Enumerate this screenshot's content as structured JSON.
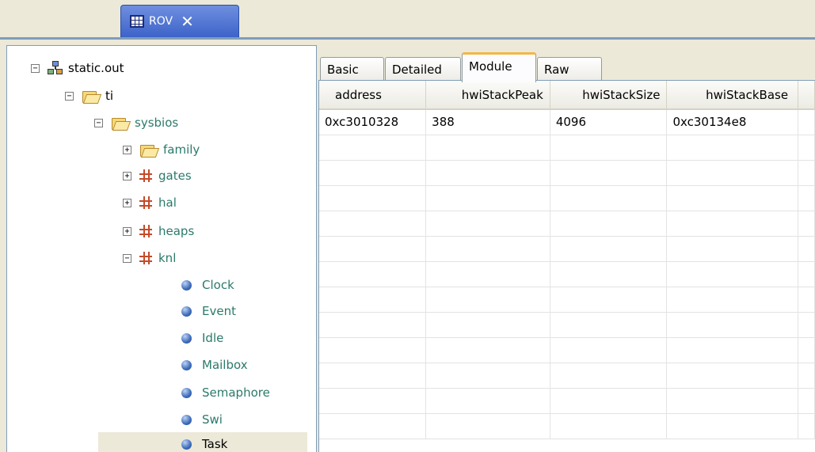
{
  "view_tab": {
    "title": "ROV",
    "icon": "table-grid-icon",
    "close_label": "✕"
  },
  "tree": {
    "root": {
      "label": "static.out",
      "icon": "project-icon",
      "toggle": "−"
    },
    "nodes": [
      {
        "label": "ti",
        "icon": "folder-icon",
        "toggle": "−",
        "color": "#000000"
      },
      {
        "label": "sysbios",
        "icon": "folder-icon",
        "toggle": "−",
        "color": "#2b7a6a"
      },
      {
        "label": "family",
        "icon": "folder-icon",
        "toggle": "+",
        "color": "#2b7a6a"
      },
      {
        "label": "gates",
        "icon": "package-icon",
        "toggle": "+",
        "color": "#2b7a6a"
      },
      {
        "label": "hal",
        "icon": "package-icon",
        "toggle": "+",
        "color": "#2b7a6a"
      },
      {
        "label": "heaps",
        "icon": "package-icon",
        "toggle": "+",
        "color": "#2b7a6a"
      },
      {
        "label": "knl",
        "icon": "package-icon",
        "toggle": "−",
        "color": "#2b7a6a"
      },
      {
        "label": "Clock",
        "icon": "module-icon",
        "color": "#2b7a6a"
      },
      {
        "label": "Event",
        "icon": "module-icon",
        "color": "#2b7a6a"
      },
      {
        "label": "Idle",
        "icon": "module-icon",
        "color": "#2b7a6a"
      },
      {
        "label": "Mailbox",
        "icon": "module-icon",
        "color": "#2b7a6a"
      },
      {
        "label": "Semaphore",
        "icon": "module-icon",
        "color": "#2b7a6a"
      },
      {
        "label": "Swi",
        "icon": "module-icon",
        "color": "#2b7a6a"
      },
      {
        "label": "Task",
        "icon": "module-icon",
        "color": "#000000",
        "selected": true
      }
    ]
  },
  "tabs": [
    {
      "label": "Basic"
    },
    {
      "label": "Detailed"
    },
    {
      "label": "Module",
      "active": true
    },
    {
      "label": "Raw"
    }
  ],
  "table": {
    "columns": [
      "address",
      "hwiStackPeak",
      "hwiStackSize",
      "hwiStackBase"
    ],
    "rows": [
      [
        "0xc3010328",
        "388",
        "4096",
        "0xc30134e8"
      ]
    ]
  }
}
